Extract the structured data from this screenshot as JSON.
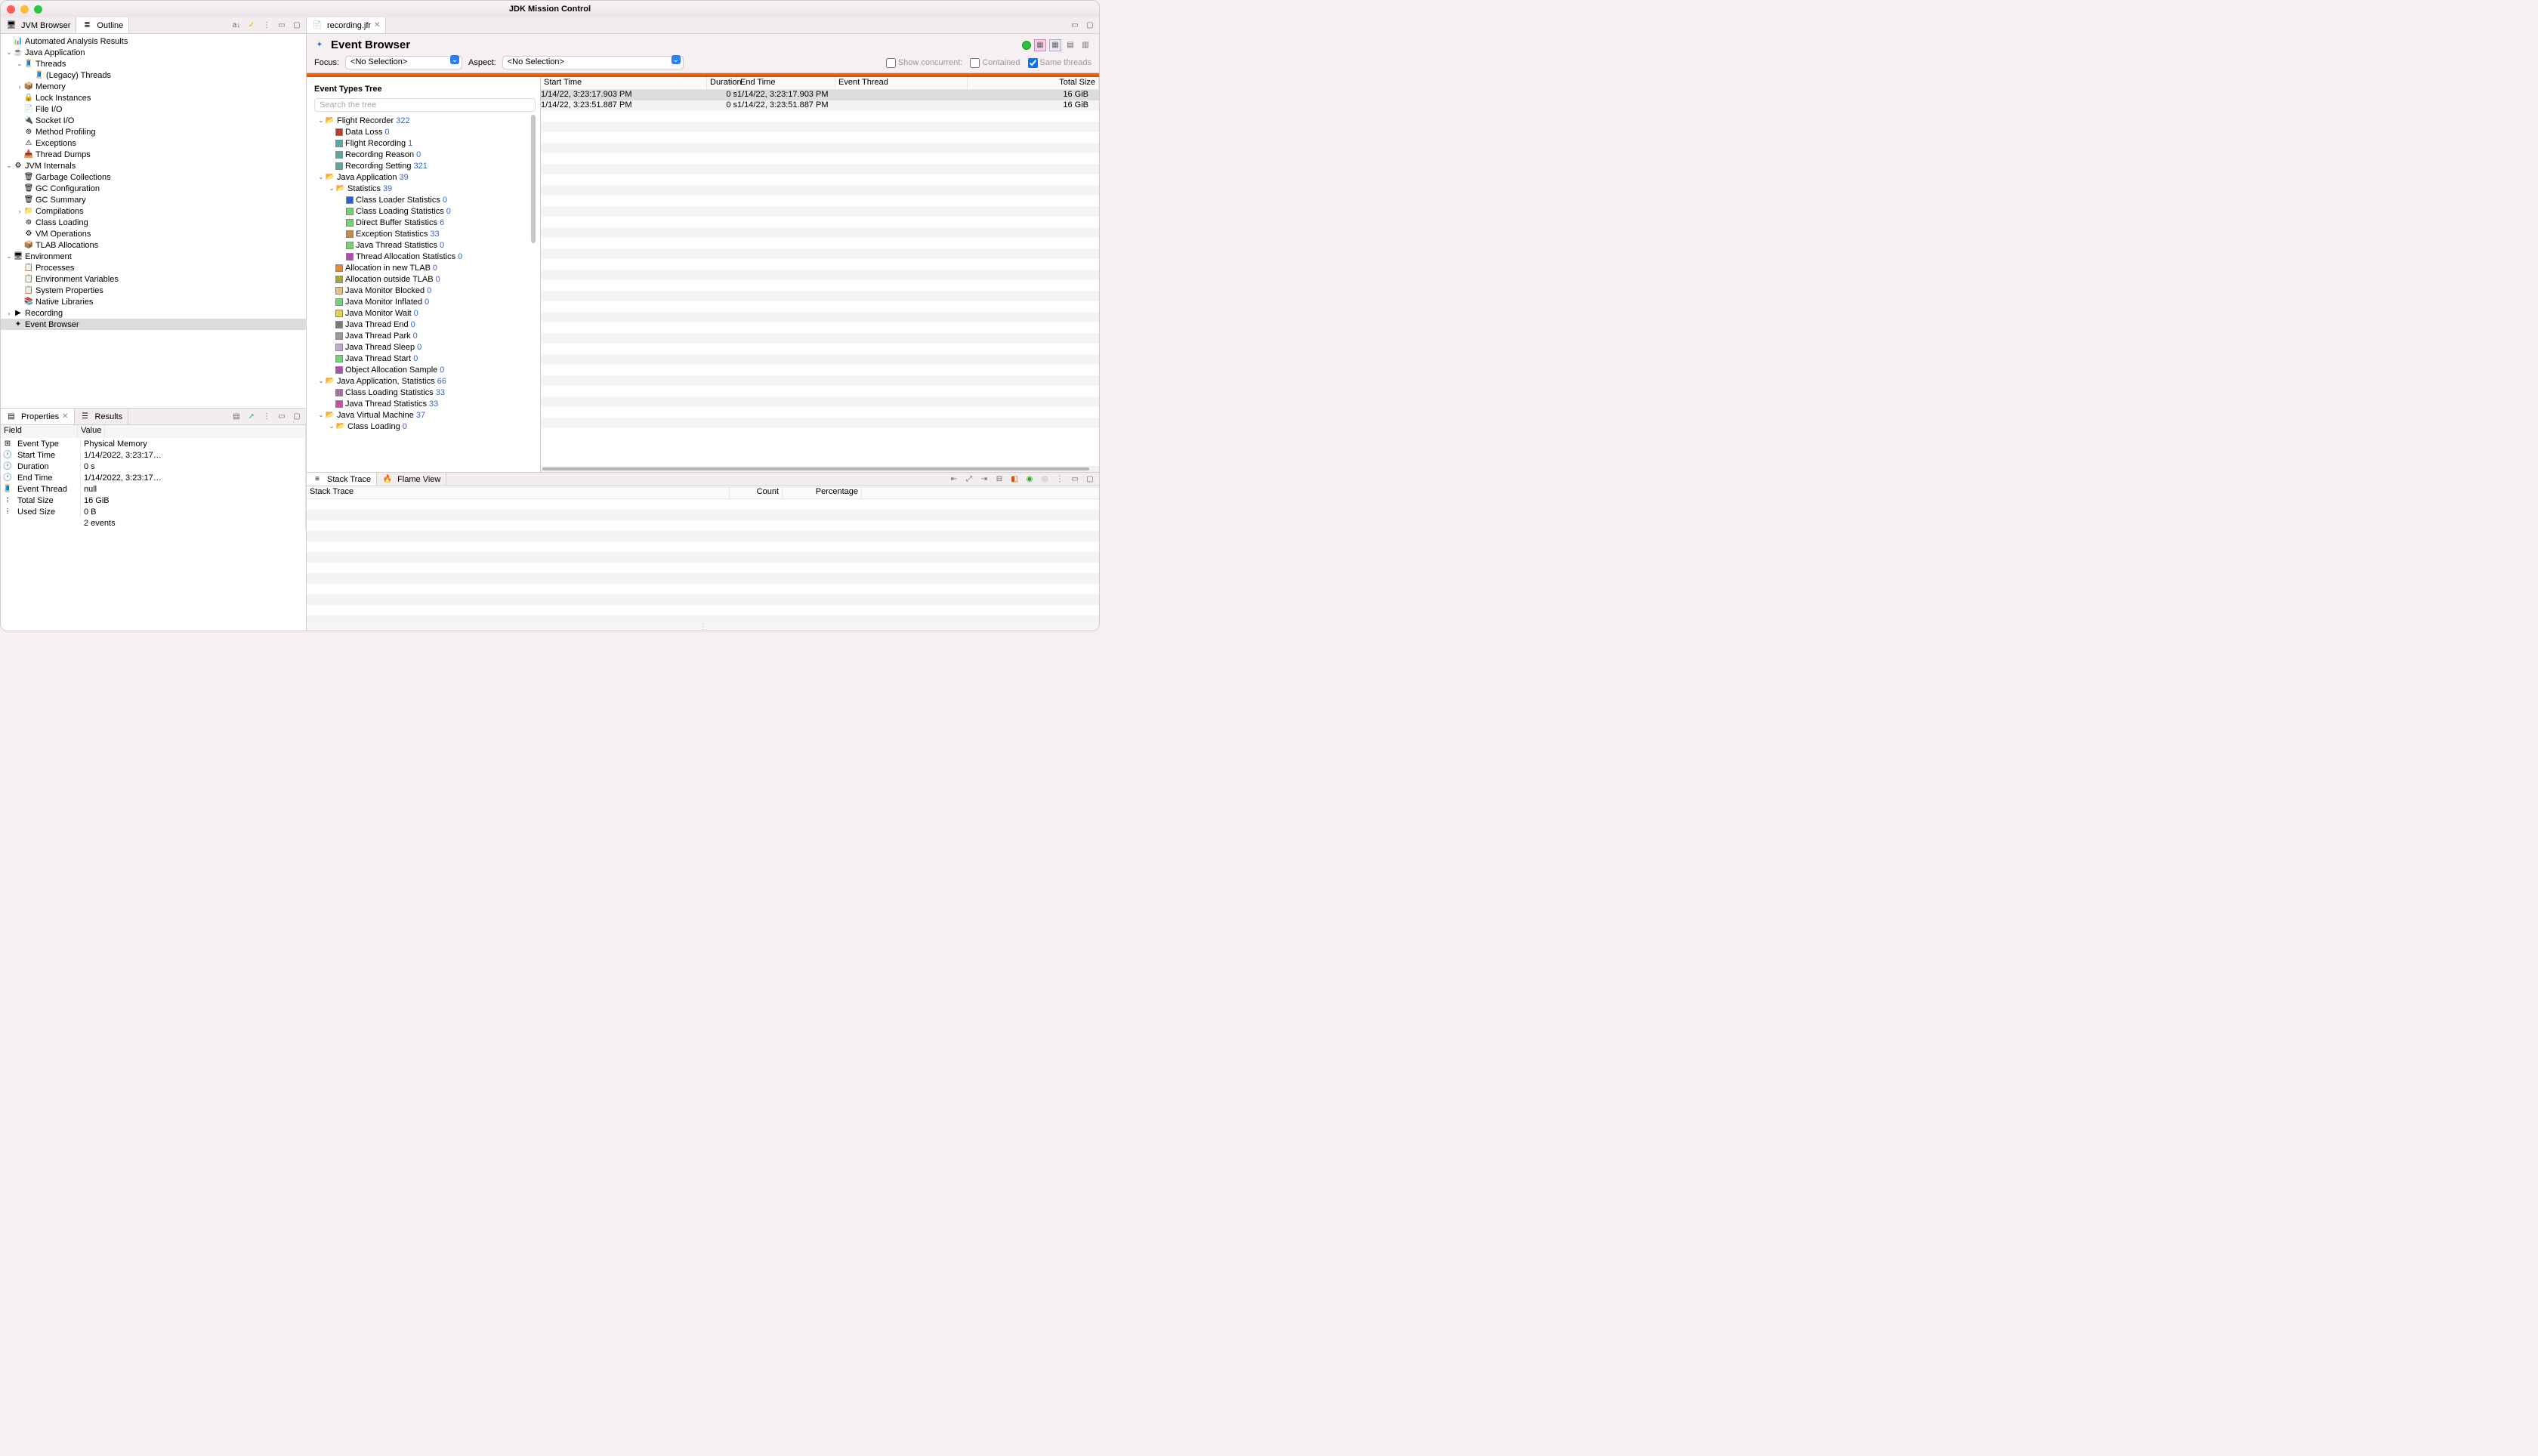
{
  "window": {
    "title": "JDK Mission Control"
  },
  "left_tabs": {
    "browser": "JVM Browser",
    "outline": "Outline"
  },
  "outline": {
    "items": [
      {
        "lvl": 0,
        "tw": "",
        "label": "Automated Analysis Results",
        "icon": "📊"
      },
      {
        "lvl": 0,
        "tw": "v",
        "label": "Java Application",
        "icon": "☕"
      },
      {
        "lvl": 1,
        "tw": "v",
        "label": "Threads",
        "icon": "🧵"
      },
      {
        "lvl": 2,
        "tw": "",
        "label": "(Legacy) Threads",
        "icon": "🧵"
      },
      {
        "lvl": 1,
        "tw": ">",
        "label": "Memory",
        "icon": "📦"
      },
      {
        "lvl": 1,
        "tw": "",
        "label": "Lock Instances",
        "icon": "🔒"
      },
      {
        "lvl": 1,
        "tw": "",
        "label": "File I/O",
        "icon": "📄"
      },
      {
        "lvl": 1,
        "tw": "",
        "label": "Socket I/O",
        "icon": "🔌"
      },
      {
        "lvl": 1,
        "tw": "",
        "label": "Method Profiling",
        "icon": "⊚"
      },
      {
        "lvl": 1,
        "tw": "",
        "label": "Exceptions",
        "icon": "⚠"
      },
      {
        "lvl": 1,
        "tw": "",
        "label": "Thread Dumps",
        "icon": "📥"
      },
      {
        "lvl": 0,
        "tw": "v",
        "label": "JVM Internals",
        "icon": "⚙"
      },
      {
        "lvl": 1,
        "tw": "",
        "label": "Garbage Collections",
        "icon": "🗑"
      },
      {
        "lvl": 1,
        "tw": "",
        "label": "GC Configuration",
        "icon": "🗑"
      },
      {
        "lvl": 1,
        "tw": "",
        "label": "GC Summary",
        "icon": "🗑"
      },
      {
        "lvl": 1,
        "tw": ">",
        "label": "Compilations",
        "icon": "📁"
      },
      {
        "lvl": 1,
        "tw": "",
        "label": "Class Loading",
        "icon": "⊚"
      },
      {
        "lvl": 1,
        "tw": "",
        "label": "VM Operations",
        "icon": "⚙"
      },
      {
        "lvl": 1,
        "tw": "",
        "label": "TLAB Allocations",
        "icon": "📦"
      },
      {
        "lvl": 0,
        "tw": "v",
        "label": "Environment",
        "icon": "🖥"
      },
      {
        "lvl": 1,
        "tw": "",
        "label": "Processes",
        "icon": "📋"
      },
      {
        "lvl": 1,
        "tw": "",
        "label": "Environment Variables",
        "icon": "📋"
      },
      {
        "lvl": 1,
        "tw": "",
        "label": "System Properties",
        "icon": "📋"
      },
      {
        "lvl": 1,
        "tw": "",
        "label": "Native Libraries",
        "icon": "📚"
      },
      {
        "lvl": 0,
        "tw": ">",
        "label": "Recording",
        "icon": "▶"
      },
      {
        "lvl": 0,
        "tw": "",
        "label": "Event Browser",
        "icon": "✦",
        "sel": true
      }
    ]
  },
  "props": {
    "tab1": "Properties",
    "tab2": "Results",
    "col_field": "Field",
    "col_value": "Value",
    "rows": [
      {
        "f": "Event Type",
        "v": "Physical Memory",
        "i": "⊞"
      },
      {
        "f": "Start Time",
        "v": "1/14/2022, 3:23:17…",
        "i": "🕐"
      },
      {
        "f": "Duration",
        "v": "0 s",
        "i": "🕐"
      },
      {
        "f": "End Time",
        "v": "1/14/2022, 3:23:17…",
        "i": "🕐"
      },
      {
        "f": "Event Thread",
        "v": "null",
        "i": "🧵"
      },
      {
        "f": "Total Size",
        "v": "16 GiB",
        "i": "⦙"
      },
      {
        "f": "Used Size",
        "v": "0 B",
        "i": "⦙"
      },
      {
        "f": "",
        "v": "2 events",
        "i": ""
      }
    ]
  },
  "editor": {
    "tab": "recording.jfr",
    "title": "Event Browser",
    "focus_label": "Focus:",
    "aspect_label": "Aspect:",
    "no_selection": "<No Selection>",
    "show_conc": "Show concurrent:",
    "contained": "Contained",
    "same_threads": "Same threads"
  },
  "event_tree": {
    "title": "Event Types Tree",
    "search_ph": "Search the tree",
    "items": [
      {
        "lvl": 0,
        "tw": "v",
        "fold": true,
        "label": "Flight Recorder",
        "ct": "322"
      },
      {
        "lvl": 1,
        "sq": "#c0392b",
        "label": "Data Loss",
        "ct": "0"
      },
      {
        "lvl": 1,
        "sq": "#5aa9a0",
        "label": "Flight Recording",
        "ct": "1"
      },
      {
        "lvl": 1,
        "sq": "#5aa9a0",
        "label": "Recording Reason",
        "ct": "0"
      },
      {
        "lvl": 1,
        "sq": "#5aa9a0",
        "label": "Recording Setting",
        "ct": "321"
      },
      {
        "lvl": 0,
        "tw": "v",
        "fold": true,
        "label": "Java Application",
        "ct": "39"
      },
      {
        "lvl": 1,
        "tw": "v",
        "fold": true,
        "label": "Statistics",
        "ct": "39"
      },
      {
        "lvl": 2,
        "sq": "#2d5fd6",
        "label": "Class Loader Statistics",
        "ct": "0"
      },
      {
        "lvl": 2,
        "sq": "#6fd66f",
        "label": "Class Loading Statistics",
        "ct": "0"
      },
      {
        "lvl": 2,
        "sq": "#6fd66f",
        "label": "Direct Buffer Statistics",
        "ct": "6"
      },
      {
        "lvl": 2,
        "sq": "#c98c3c",
        "label": "Exception Statistics",
        "ct": "33"
      },
      {
        "lvl": 2,
        "sq": "#6fd66f",
        "label": "Java Thread Statistics",
        "ct": "0"
      },
      {
        "lvl": 2,
        "sq": "#b548b5",
        "label": "Thread Allocation Statistics",
        "ct": "0"
      },
      {
        "lvl": 1,
        "sq": "#e38b2f",
        "label": "Allocation in new TLAB",
        "ct": "0"
      },
      {
        "lvl": 1,
        "sq": "#a5a53c",
        "label": "Allocation outside TLAB",
        "ct": "0"
      },
      {
        "lvl": 1,
        "sq": "#e3c37a",
        "label": "Java Monitor Blocked",
        "ct": "0"
      },
      {
        "lvl": 1,
        "sq": "#6fd66f",
        "label": "Java Monitor Inflated",
        "ct": "0"
      },
      {
        "lvl": 1,
        "sq": "#e6d24a",
        "label": "Java Monitor Wait",
        "ct": "0"
      },
      {
        "lvl": 1,
        "sq": "#7a7a7a",
        "label": "Java Thread End",
        "ct": "0"
      },
      {
        "lvl": 1,
        "sq": "#9a9a9a",
        "label": "Java Thread Park",
        "ct": "0"
      },
      {
        "lvl": 1,
        "sq": "#c0a8d8",
        "label": "Java Thread Sleep",
        "ct": "0"
      },
      {
        "lvl": 1,
        "sq": "#6fd66f",
        "label": "Java Thread Start",
        "ct": "0"
      },
      {
        "lvl": 1,
        "sq": "#b548b5",
        "label": "Object Allocation Sample",
        "ct": "0"
      },
      {
        "lvl": 0,
        "tw": "v",
        "fold": true,
        "label": "Java Application, Statistics",
        "ct": "66"
      },
      {
        "lvl": 1,
        "sq": "#a46fa4",
        "label": "Class Loading Statistics",
        "ct": "33"
      },
      {
        "lvl": 1,
        "sq": "#c94fa4",
        "label": "Java Thread Statistics",
        "ct": "33"
      },
      {
        "lvl": 0,
        "tw": "v",
        "fold": true,
        "label": "Java Virtual Machine",
        "ct": "37"
      },
      {
        "lvl": 1,
        "tw": "v",
        "fold": true,
        "label": "Class Loading",
        "ct": "0"
      }
    ]
  },
  "event_table": {
    "cols": {
      "start": "Start Time",
      "dur": "Duration",
      "end": "End Time",
      "thread": "Event Thread",
      "size": "Total Size"
    },
    "rows": [
      {
        "start": "1/14/22, 3:23:17.903 PM",
        "dur": "0 s",
        "end": "1/14/22, 3:23:17.903 PM",
        "thread": "",
        "size": "16 GiB",
        "sel": true
      },
      {
        "start": "1/14/22, 3:23:51.887 PM",
        "dur": "0 s",
        "end": "1/14/22, 3:23:51.887 PM",
        "thread": "",
        "size": "16 GiB"
      }
    ]
  },
  "bottom": {
    "tab1": "Stack Trace",
    "tab2": "Flame View",
    "cols": {
      "st": "Stack Trace",
      "cnt": "Count",
      "pct": "Percentage"
    }
  }
}
